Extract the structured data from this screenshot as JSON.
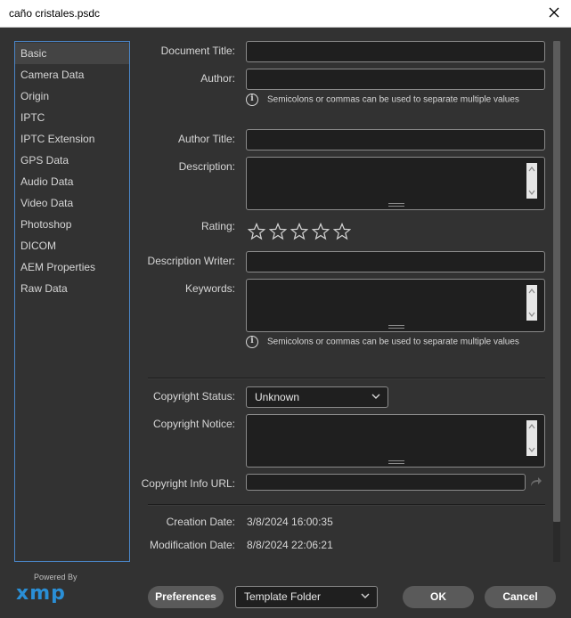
{
  "window": {
    "title": "caño cristales.psdc"
  },
  "sidebar": {
    "items": [
      {
        "label": "Basic",
        "active": true
      },
      {
        "label": "Camera Data"
      },
      {
        "label": "Origin"
      },
      {
        "label": "IPTC"
      },
      {
        "label": "IPTC Extension"
      },
      {
        "label": "GPS Data"
      },
      {
        "label": "Audio Data"
      },
      {
        "label": "Video Data"
      },
      {
        "label": "Photoshop"
      },
      {
        "label": "DICOM"
      },
      {
        "label": "AEM Properties"
      },
      {
        "label": "Raw Data"
      }
    ]
  },
  "logo": {
    "powered_by": "Powered By",
    "brand": "xmp"
  },
  "form": {
    "document_title": {
      "label": "Document Title:",
      "value": ""
    },
    "author": {
      "label": "Author:",
      "value": ""
    },
    "author_hint": "Semicolons or commas can be used to separate multiple values",
    "author_title": {
      "label": "Author Title:",
      "value": ""
    },
    "description": {
      "label": "Description:",
      "value": ""
    },
    "rating": {
      "label": "Rating:",
      "value": 0,
      "max": 5
    },
    "description_writer": {
      "label": "Description Writer:",
      "value": ""
    },
    "keywords": {
      "label": "Keywords:",
      "value": ""
    },
    "keywords_hint": "Semicolons or commas can be used to separate multiple values",
    "copyright_status": {
      "label": "Copyright Status:",
      "value": "Unknown"
    },
    "copyright_notice": {
      "label": "Copyright Notice:",
      "value": ""
    },
    "copyright_url": {
      "label": "Copyright Info URL:",
      "value": ""
    },
    "creation_date": {
      "label": "Creation Date:",
      "value": "3/8/2024 16:00:35"
    },
    "modification_date": {
      "label": "Modification Date:",
      "value": "8/8/2024 22:06:21"
    }
  },
  "footer": {
    "preferences_label": "Preferences",
    "template_folder": "Template Folder",
    "ok_label": "OK",
    "cancel_label": "Cancel"
  },
  "colors": {
    "background": "#323232",
    "field": "#1f1f1f",
    "sidebar_border": "#4a86c9",
    "button": "#5a5a5a"
  }
}
